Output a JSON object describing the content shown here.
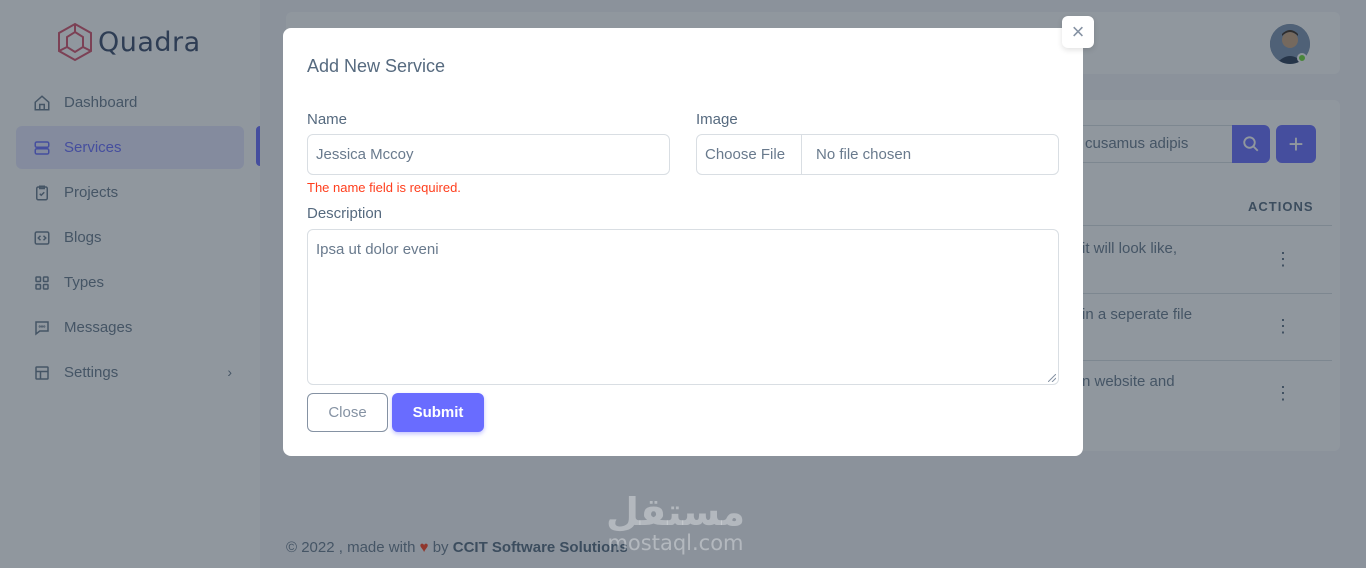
{
  "app": {
    "logo_text": "Quadra"
  },
  "sidebar": {
    "items": [
      {
        "label": "Dashboard",
        "icon": "home-icon"
      },
      {
        "label": "Services",
        "icon": "server-icon",
        "active": true
      },
      {
        "label": "Projects",
        "icon": "clipboard-icon"
      },
      {
        "label": "Blogs",
        "icon": "code-icon"
      },
      {
        "label": "Types",
        "icon": "grid-icon"
      },
      {
        "label": "Messages",
        "icon": "message-icon"
      },
      {
        "label": "Settings",
        "icon": "layout-icon",
        "has_submenu": true
      }
    ]
  },
  "background": {
    "search_value": "cusamus adipis",
    "actions_header": "ACTIONS",
    "rows": [
      "it will look like,",
      "in a seperate file",
      "n website and"
    ]
  },
  "footer": {
    "prefix": "© 2022 , made with",
    "by": "by",
    "company": "CCIT Software Solutions"
  },
  "watermark": {
    "arabic": "مستقل",
    "latin": "mostaql.com"
  },
  "modal": {
    "title": "Add New Service",
    "close_glyph": "×",
    "name_label": "Name",
    "name_value": "Jessica Mccoy",
    "name_error": "The name field is required.",
    "image_label": "Image",
    "file_button": "Choose File",
    "file_status": "No file chosen",
    "description_label": "Description",
    "description_value": "Ipsa ut dolor eveni",
    "close_button": "Close",
    "submit_button": "Submit"
  },
  "colors": {
    "primary": "#696cff",
    "error": "#ff3e1d",
    "text": "#697a8d"
  }
}
